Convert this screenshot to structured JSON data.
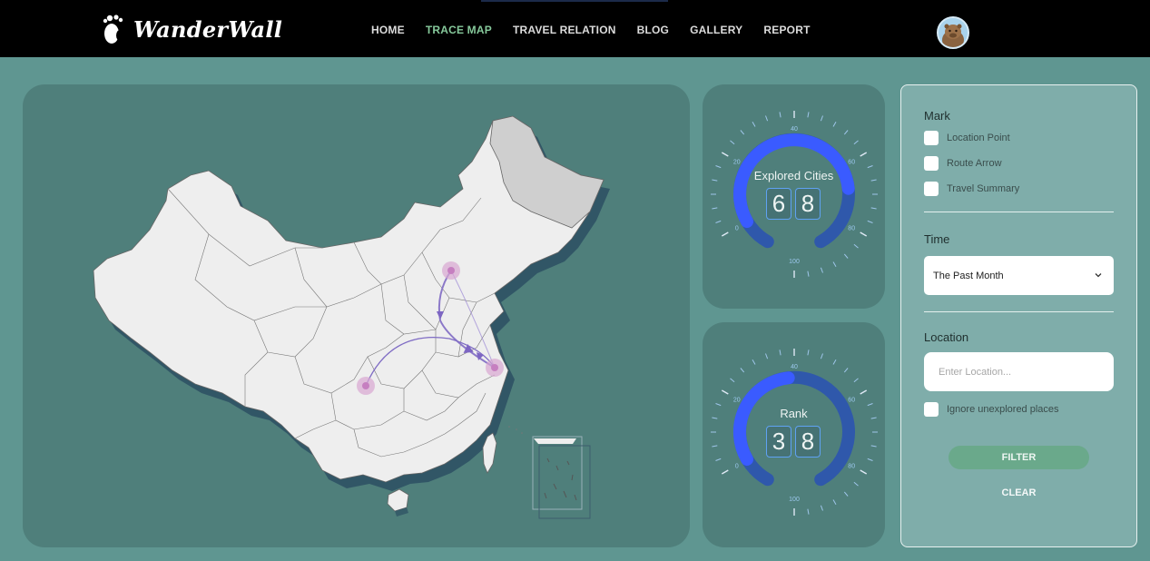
{
  "brand": {
    "name": "WanderWall"
  },
  "nav": {
    "items": [
      {
        "label": "HOME",
        "active": false
      },
      {
        "label": "TRACE MAP",
        "active": true
      },
      {
        "label": "TRAVEL RELATION",
        "active": false
      },
      {
        "label": "BLOG",
        "active": false
      },
      {
        "label": "GALLERY",
        "active": false
      },
      {
        "label": "REPORT",
        "active": false
      }
    ]
  },
  "gauges": {
    "cities": {
      "title": "Explored Cities",
      "digits": [
        "6",
        "8"
      ],
      "value": 68,
      "ticks": [
        "0",
        "20",
        "40",
        "60",
        "80",
        "100"
      ]
    },
    "rank": {
      "title": "Rank",
      "digits": [
        "3",
        "8"
      ],
      "value": 38,
      "ticks": [
        "0",
        "20",
        "40",
        "60",
        "80",
        "100"
      ]
    }
  },
  "filter": {
    "mark_title": "Mark",
    "mark_options": [
      "Location Point",
      "Route Arrow",
      "Travel Summary"
    ],
    "time_title": "Time",
    "time_selected": "The Past Month",
    "location_title": "Location",
    "location_placeholder": "Enter Location...",
    "ignore_label": "Ignore unexplored places",
    "filter_button": "FILTER",
    "clear_button": "CLEAR"
  },
  "colors": {
    "background": "#5f9691",
    "panel": "#4f7f7b",
    "active_nav": "#86c99b",
    "gauge_accent": "#3a5bff",
    "filter_button": "#6aa98b"
  },
  "icons": {
    "brand": "footprint-icon",
    "select": "chevron-down-icon",
    "avatar": "capybara-avatar"
  }
}
